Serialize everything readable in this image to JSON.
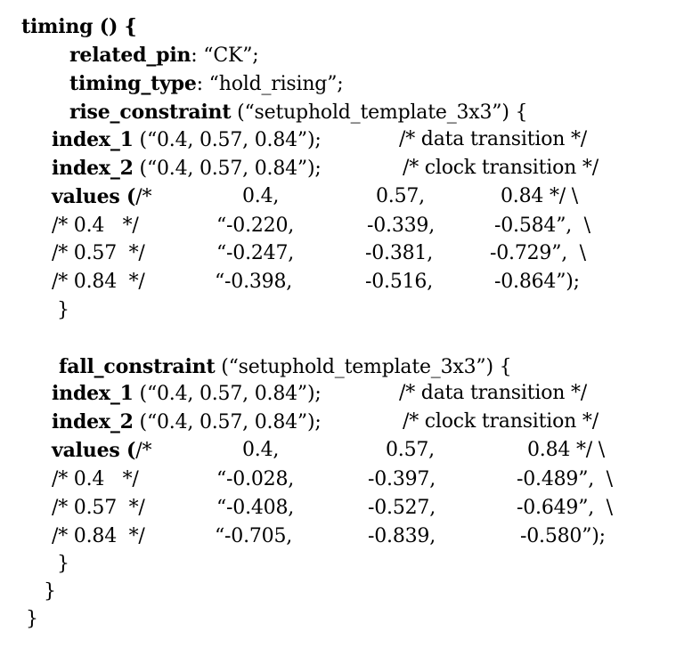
{
  "timing": {
    "open": "timing () {",
    "related_pin_key": "related_pin",
    "related_pin_val": ": “CK”;",
    "timing_type_key": "timing_type",
    "timing_type_val": ": “hold_rising”;",
    "close_inner": "}",
    "close_outer": "}"
  },
  "rise": {
    "key": "rise_constraint",
    "template": " (“setuphold_template_3x3”) {",
    "index1_key": "index_1",
    "index1_val": " (“0.4, 0.57, 0.84”);",
    "index1_comment": "/* data transition */",
    "index2_key": "index_2",
    "index2_val": " (“0.4, 0.57, 0.84”);",
    "index2_comment": "/* clock transition */",
    "values_key": "values (",
    "values_hdr_open": "/*",
    "values_hdr": [
      "0.4,",
      "0.57,",
      "0.84 */ \\"
    ],
    "rows": [
      {
        "label": "/* 0.4   */",
        "v1": "“-0.220,",
        "v2": "-0.339,",
        "v3": "-0.584”,  \\"
      },
      {
        "label": "/* 0.57  */",
        "v1": "“-0.247,",
        "v2": "-0.381,",
        "v3": "-0.729”,  \\"
      },
      {
        "label": "/* 0.84  */",
        "v1": "“-0.398,",
        "v2": "-0.516,",
        "v3": "-0.864”);"
      }
    ],
    "close": "}"
  },
  "fall": {
    "key": "fall_constraint",
    "template": " (“setuphold_template_3x3”) {",
    "index1_key": "index_1",
    "index1_val": " (“0.4, 0.57, 0.84”);",
    "index1_comment": "/* data transition */",
    "index2_key": "index_2",
    "index2_val": " (“0.4, 0.57, 0.84”);",
    "index2_comment": "/* clock transition */",
    "values_key": "values (",
    "values_hdr_open": "/*",
    "values_hdr": [
      "0.4,",
      "0.57,",
      "0.84 */ \\"
    ],
    "rows": [
      {
        "label": "/* 0.4   */",
        "v1": "“-0.028,",
        "v2": "-0.397,",
        "v3": "-0.489”,  \\"
      },
      {
        "label": "/* 0.57  */",
        "v1": "“-0.408,",
        "v2": "-0.527,",
        "v3": "-0.649”,  \\"
      },
      {
        "label": "/* 0.84  */",
        "v1": "“-0.705,",
        "v2": "-0.839,",
        "v3": "-0.580”);"
      }
    ],
    "close": "}"
  }
}
